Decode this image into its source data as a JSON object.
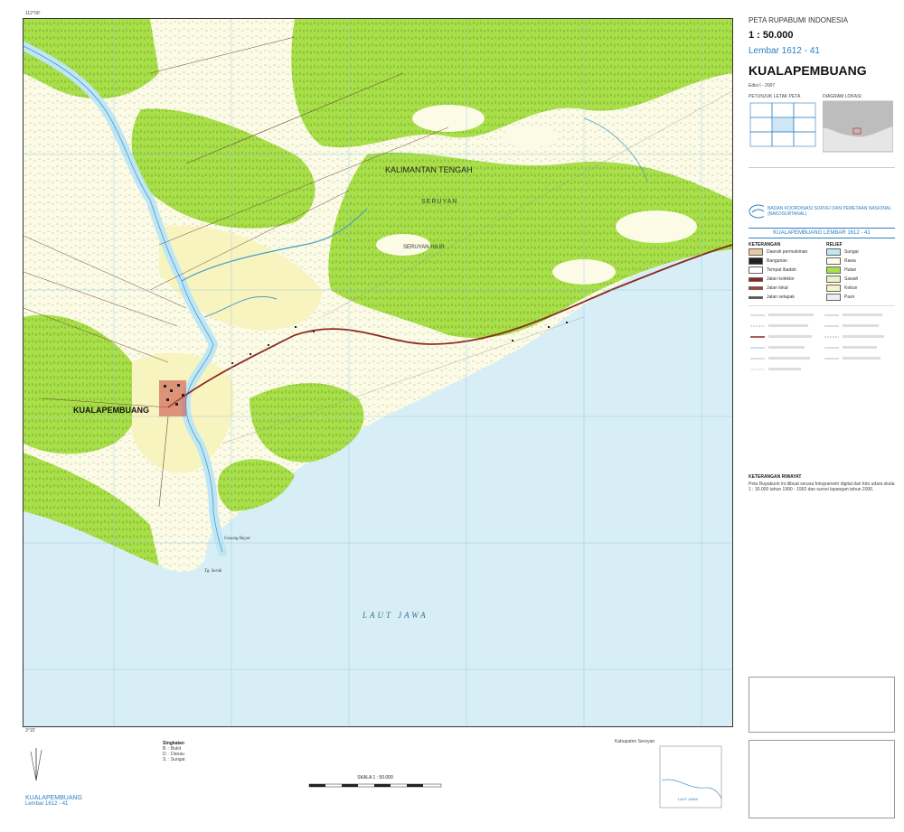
{
  "header": {
    "series": "PETA RUPABUMI INDONESIA",
    "scale": "1 : 50.000",
    "sheet": "Lembar 1612 - 41",
    "title": "KUALAPEMBUANG",
    "edition": "Edisi I - 2007"
  },
  "map": {
    "region_label": "KALIMANTAN TENGAH",
    "district_label": "SERUYAN",
    "subdistrict_label": "SERUYAN HILIR",
    "town_label": "KUALAPEMBUANG",
    "sea_label": "LAUT JAWA",
    "cape_label": "Tg. Seruk",
    "point_label": "Gosong Bayur",
    "colors": {
      "sea": "#d7eef6",
      "forest": "#a9e04a",
      "cultivated": "#f8f4bf",
      "swamp": "#fbfbe6",
      "river": "#bfe6f4",
      "road": "#8b2a1f"
    }
  },
  "right_panel": {
    "index_title": "PETUNJUK LETAK PETA",
    "diagram_title": "DIAGRAM LOKASI",
    "section_heading": "KUALAPEMBUANG  LEMBAR 1612 - 41",
    "legend_heading_left": "KETERANGAN",
    "legend_heading_right": "RELIEF",
    "legend_items": [
      "Daerah permukiman",
      "Bangunan",
      "Tempat ibadah",
      "Jalan kolektor",
      "Jalan lokal",
      "Jalan setapak",
      "Sungai",
      "Rawa",
      "Hutan",
      "Sawah",
      "Kebun",
      "Pasir"
    ],
    "notes_heading": "KETERANGAN RIWAYAT",
    "notes_text": "Peta Rupabumi ini dibuat secara fotogrametri digital dan foto udara skala 1 : 30.000 tahun 1990 - 1992 dan survei lapangan tahun 2006.",
    "publisher_text": "BADAN KOORDINASI SURVEI DAN PEMETAAN NASIONAL (BAKOSURTANAL)"
  },
  "bottom": {
    "left_label": "KUALAPEMBUANG",
    "left_sheet": "Lembar 1612 - 41",
    "abbrev_title": "Singkatan",
    "abbrev_items": [
      "B. : Bukit",
      "D. : Danau",
      "S. : Sungai"
    ],
    "scale_label": "SKALA 1 : 50.000",
    "inset_title": "Kabupaten Seruyan",
    "inset_sea": "LAUT JAWA"
  }
}
